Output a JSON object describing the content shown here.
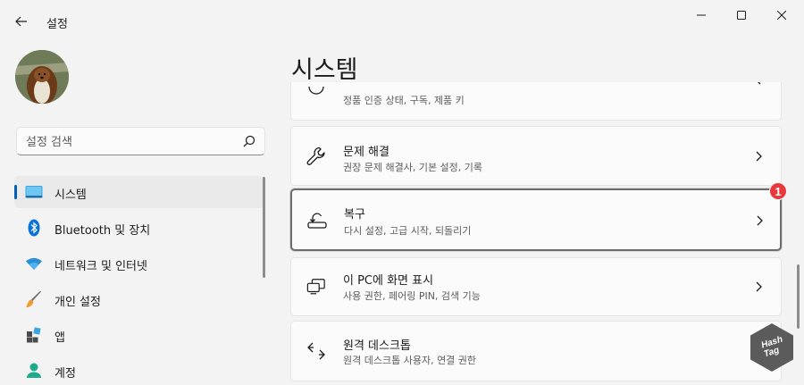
{
  "app": {
    "title": "설정"
  },
  "window_controls": {
    "minimize_icon": "minimize-icon",
    "maximize_icon": "maximize-icon",
    "close_icon": "close-icon"
  },
  "search": {
    "placeholder": "설정 검색",
    "icon": "search-icon"
  },
  "sidebar": {
    "items": [
      {
        "label": "시스템",
        "icon": "system-display-icon",
        "selected": true
      },
      {
        "label": "Bluetooth 및 장치",
        "icon": "bluetooth-icon"
      },
      {
        "label": "네트워크 및 인터넷",
        "icon": "wifi-icon"
      },
      {
        "label": "개인 설정",
        "icon": "paintbrush-icon"
      },
      {
        "label": "앱",
        "icon": "apps-icon"
      },
      {
        "label": "계정",
        "icon": "account-icon"
      }
    ]
  },
  "main": {
    "title": "시스템",
    "cards": [
      {
        "title": "",
        "desc": "정품 인증 상태, 구독, 제품 키",
        "icon": "activation-icon"
      },
      {
        "title": "문제 해결",
        "desc": "권장 문제 해결사, 기본 설정, 기록",
        "icon": "wrench-icon"
      },
      {
        "title": "복구",
        "desc": "다시 설정, 고급 시작, 되돌리기",
        "icon": "recovery-icon"
      },
      {
        "title": "이 PC에 화면 표시",
        "desc": "사용 권한, 페어링 PIN, 검색 기능",
        "icon": "project-screen-icon"
      },
      {
        "title": "원격 데스크톱",
        "desc": "원격 데스크톱 사용자, 연결 권한",
        "icon": "remote-desktop-icon"
      }
    ]
  },
  "annotation": {
    "badge": "1"
  },
  "watermark": {
    "line1": "Hash",
    "line2": "Tag"
  },
  "colors": {
    "accent": "#005fb8",
    "badge": "#e8393c",
    "background": "#f3f3f3",
    "card": "#fbfbfb"
  }
}
